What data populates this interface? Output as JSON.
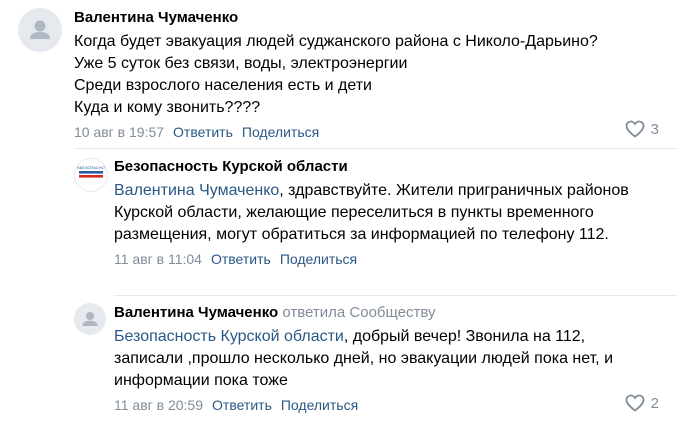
{
  "comments": [
    {
      "author": "Валентина Чумаченко",
      "text": "Когда будет эвакуация людей суджанского района с Николо-Дарьино?\nУже 5 суток без связи, воды, электроэнергии\nСреди взрослого населения есть и дети\nКуда и кому звонить????",
      "date": "10 авг в 19:57",
      "reply_label": "Ответить",
      "share_label": "Поделиться",
      "likes": "3"
    },
    {
      "author": "Безопасность Курской области",
      "avatar_text": "КБЕЗОПАСНО",
      "mention": "Валентина Чумаченко",
      "text": ", здравствуйте. Жители приграничных районов Курской области, желающие переселиться в пункты временного размещения, могут обратиться за информацией по телефону 112.",
      "date": "11 авг в 11:04",
      "reply_label": "Ответить",
      "share_label": "Поделиться"
    },
    {
      "author": "Валентина Чумаченко",
      "replied_to": "ответила Сообществу",
      "mention": "Безопасность Курской области",
      "text": ", добрый вечер! Звонила на 112, записали ,прошло несколько дней, но эвакуации людей пока нет, и информации пока тоже",
      "date": "11 авг в 20:59",
      "reply_label": "Ответить",
      "share_label": "Поделиться",
      "likes": "2"
    }
  ],
  "colors": {
    "link": "#2a5885",
    "meta": "#818c99",
    "avatar_bg": "#e6e9ee",
    "divider": "#e7e8ec",
    "logo_blue": "#2d5aa0",
    "logo_red": "#d52b1e"
  },
  "icons": [
    "user-avatar-icon",
    "heart-icon",
    "community-logo-icon"
  ]
}
